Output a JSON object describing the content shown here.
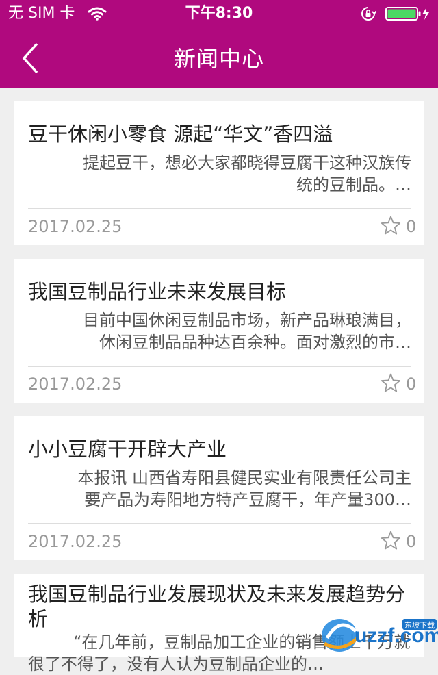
{
  "status_bar": {
    "carrier": "无 SIM 卡",
    "time": "下午8:30"
  },
  "nav": {
    "title": "新闻中心",
    "back_icon": "chevron-left-icon"
  },
  "news": [
    {
      "title": "豆干休闲小零食 源起“华文”香四溢",
      "summary": "提起豆干，想必大家都晓得豆腐干这种汉族传统的豆制品。…",
      "date": "2017.02.25",
      "count": "0"
    },
    {
      "title": "我国豆制品行业未来发展目标",
      "summary": "目前中国休闲豆制品市场，新产品琳琅满目，休闲豆制品品种达百余种。面对激烈的市…",
      "date": "2017.02.25",
      "count": "0"
    },
    {
      "title": "小小豆腐干开辟大产业",
      "summary": "本报讯 山西省寿阳县健民实业有限责任公司主要产品为寿阳地方特产豆腐干，年产量300…",
      "date": "2017.02.25",
      "count": "0"
    },
    {
      "title": "我国豆制品行业发展现状及未来发展趋势分析",
      "summary": "“在几年前，豆制品加工企业的销售额上千万就很了不得了，没有人认为豆制品企业的…",
      "date": "",
      "count": ""
    }
  ],
  "watermark": {
    "text": "uzzf.com",
    "subtext": "东坡下载"
  },
  "colors": {
    "brand": "#b0097e",
    "background": "#efefef",
    "battery": "#4cd964"
  }
}
